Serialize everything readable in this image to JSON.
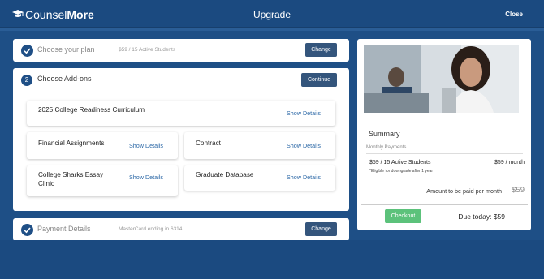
{
  "header": {
    "logo_prefix": "C",
    "logo_light": "ounsel",
    "logo_bold": "More",
    "title": "Upgrade",
    "close_label": "Close"
  },
  "steps": {
    "plan": {
      "label": "Choose your plan",
      "sub": "$59 / 15 Active Students",
      "button": "Change"
    },
    "addons": {
      "number": "2",
      "label": "Choose Add-ons",
      "button": "Continue"
    },
    "payment": {
      "label": "Payment Details",
      "sub": "MasterCard ending in 6314",
      "button": "Change"
    }
  },
  "addons": [
    {
      "name": "2025 College Readiness Curriculum",
      "link": "Show Details"
    },
    {
      "name": "Financial Assignments",
      "link": "Show Details"
    },
    {
      "name": "Contract",
      "link": "Show Details"
    },
    {
      "name": "College Sharks Essay Clinic",
      "link": "Show Details"
    },
    {
      "name": "Graduate Database",
      "link": "Show Details"
    }
  ],
  "summary": {
    "title": "Summary",
    "monthly_label": "Monthly Payments",
    "plan": "$59 / 15 Active Students",
    "price": "$59 / month",
    "note": "*Eligible for downgrade after 1 year",
    "amount_label": "Amount to be paid per month",
    "amount": "$59",
    "checkout": "Checkout",
    "due": "Due today: $59"
  },
  "colors": {
    "background": "#1e4f86",
    "accent": "#1f4f86",
    "button": "#34557c",
    "checkout": "#5cc27b",
    "link": "#2a67a6"
  }
}
